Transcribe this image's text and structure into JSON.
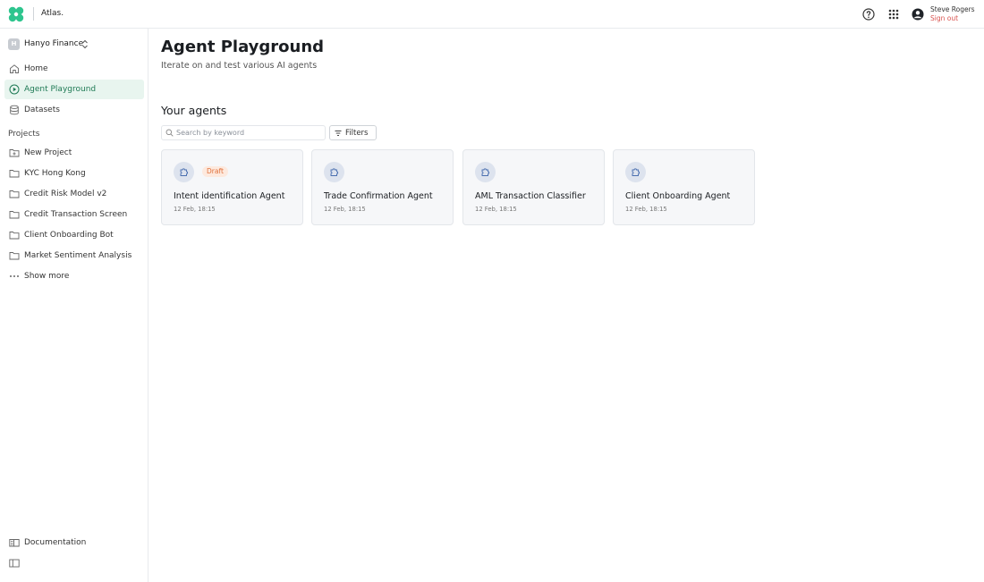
{
  "app": {
    "name": "Atlas."
  },
  "user": {
    "name": "Steve Rogers",
    "sign_out": "Sign out"
  },
  "org": {
    "initial": "H",
    "name": "Hanyo Finance"
  },
  "nav": [
    {
      "label": "Home",
      "icon": "home-icon",
      "active": false
    },
    {
      "label": "Agent Playground",
      "icon": "play-circle-icon",
      "active": true
    },
    {
      "label": "Datasets",
      "icon": "database-icon",
      "active": false
    }
  ],
  "projects": {
    "title": "Projects",
    "items": [
      {
        "label": "New Project",
        "icon": "folder-plus-icon"
      },
      {
        "label": "KYC Hong Kong",
        "icon": "folder-icon"
      },
      {
        "label": "Credit Risk Model v2",
        "icon": "folder-icon"
      },
      {
        "label": "Credit Transaction Screen",
        "icon": "folder-icon"
      },
      {
        "label": "Client Onboarding Bot",
        "icon": "folder-icon"
      },
      {
        "label": "Market Sentiment Analysis",
        "icon": "folder-icon"
      },
      {
        "label": "Show more",
        "icon": "more-icon"
      }
    ]
  },
  "footer": {
    "documentation": "Documentation"
  },
  "page": {
    "title": "Agent Playground",
    "subtitle": "Iterate on and test various AI agents",
    "section_title": "Your agents"
  },
  "search": {
    "placeholder": "Search by keyword",
    "value": ""
  },
  "filters_label": "Filters",
  "agents": [
    {
      "name": "Intent identification Agent",
      "date": "12 Feb, 18:15",
      "badge": "Draft"
    },
    {
      "name": "Trade Confirmation Agent",
      "date": "12 Feb, 18:15",
      "badge": ""
    },
    {
      "name": "AML Transaction Classifier",
      "date": "12 Feb, 18:15",
      "badge": ""
    },
    {
      "name": "Client Onboarding Agent",
      "date": "12 Feb, 18:15",
      "badge": ""
    }
  ],
  "colors": {
    "accent": "#1f7a55",
    "active_bg": "#e8f5ef",
    "logo": "#2ec58e",
    "draft": "#e0703a",
    "sign_out": "#d9534f"
  }
}
